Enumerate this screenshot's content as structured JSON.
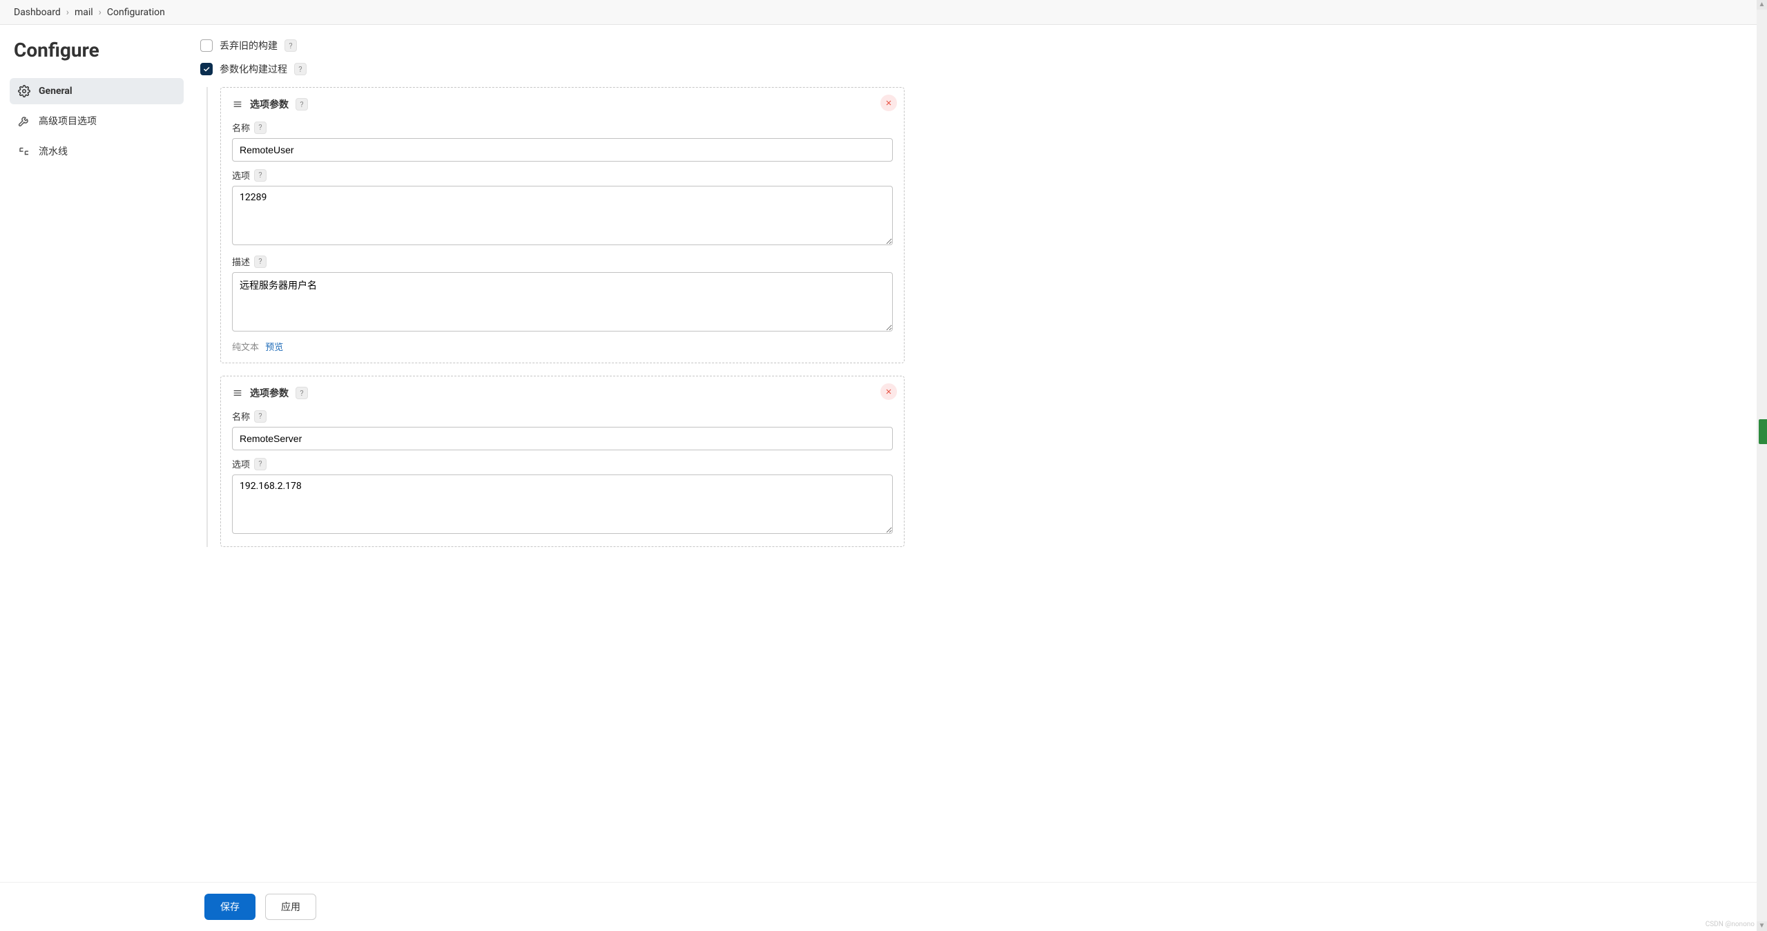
{
  "breadcrumb": [
    "Dashboard",
    "mail",
    "Configuration"
  ],
  "sidebar": {
    "title": "Configure",
    "items": [
      {
        "label": "General",
        "icon": "gear"
      },
      {
        "label": "高级项目选项",
        "icon": "wrench"
      },
      {
        "label": "流水线",
        "icon": "pipeline"
      }
    ],
    "active_index": 0
  },
  "options": {
    "discard_old": {
      "label": "丢弃旧的构建",
      "checked": false
    },
    "parameterized": {
      "label": "参数化构建过程",
      "checked": true
    }
  },
  "param_card_title": "选项参数",
  "field_labels": {
    "name": "名称",
    "choices": "选项",
    "description": "描述"
  },
  "desc_mode": {
    "plain": "纯文本",
    "preview": "预览"
  },
  "parameters": [
    {
      "name": "RemoteUser",
      "choices": "12289",
      "description": "远程服务器用户名"
    },
    {
      "name": "RemoteServer",
      "choices": "192.168.2.178",
      "description": ""
    }
  ],
  "footer": {
    "save": "保存",
    "apply": "应用"
  },
  "watermark": "CSDN @nonono"
}
